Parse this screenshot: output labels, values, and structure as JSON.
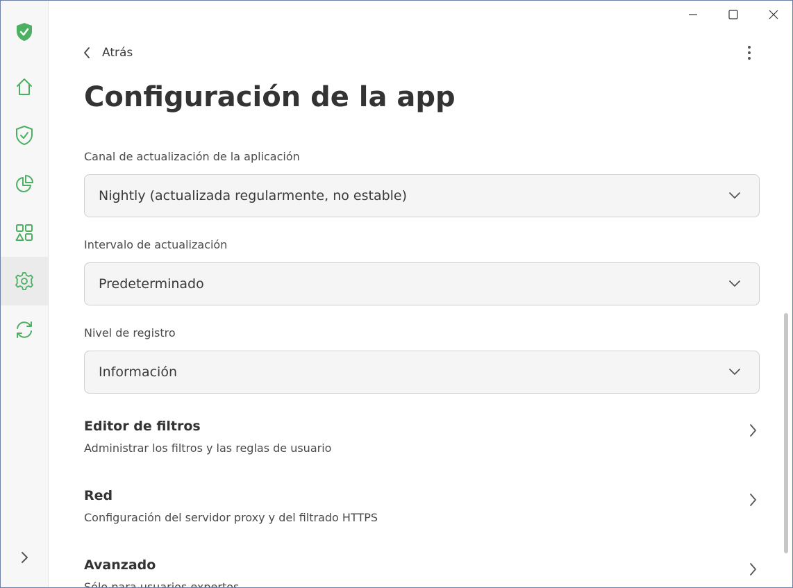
{
  "window": {
    "controls": [
      "minimize",
      "maximize",
      "close"
    ]
  },
  "sidebar": {
    "items": [
      {
        "id": "logo",
        "icon": "shield-check-filled-icon"
      },
      {
        "id": "home",
        "icon": "home-icon"
      },
      {
        "id": "protection",
        "icon": "shield-check-icon"
      },
      {
        "id": "statistics",
        "icon": "pie-chart-icon"
      },
      {
        "id": "apps",
        "icon": "apps-icon"
      },
      {
        "id": "settings",
        "icon": "gear-icon",
        "active": true
      },
      {
        "id": "sync",
        "icon": "sync-icon"
      },
      {
        "id": "expand",
        "icon": "chevron-right-icon"
      }
    ],
    "accent": "#4caf62"
  },
  "header": {
    "back_label": "Atrás",
    "title": "Configuración de la app"
  },
  "fields": [
    {
      "label": "Canal de actualización de la aplicación",
      "value": "Nightly (actualizada regularmente, no estable)"
    },
    {
      "label": "Intervalo de actualización",
      "value": "Predeterminado"
    },
    {
      "label": "Nivel de registro",
      "value": "Información"
    }
  ],
  "nav": [
    {
      "title": "Editor de filtros",
      "description": "Administrar los filtros y las reglas de usuario"
    },
    {
      "title": "Red",
      "description": "Configuración del servidor proxy y del filtrado HTTPS"
    },
    {
      "title": "Avanzado",
      "description": "Sólo para usuarios expertos"
    }
  ]
}
